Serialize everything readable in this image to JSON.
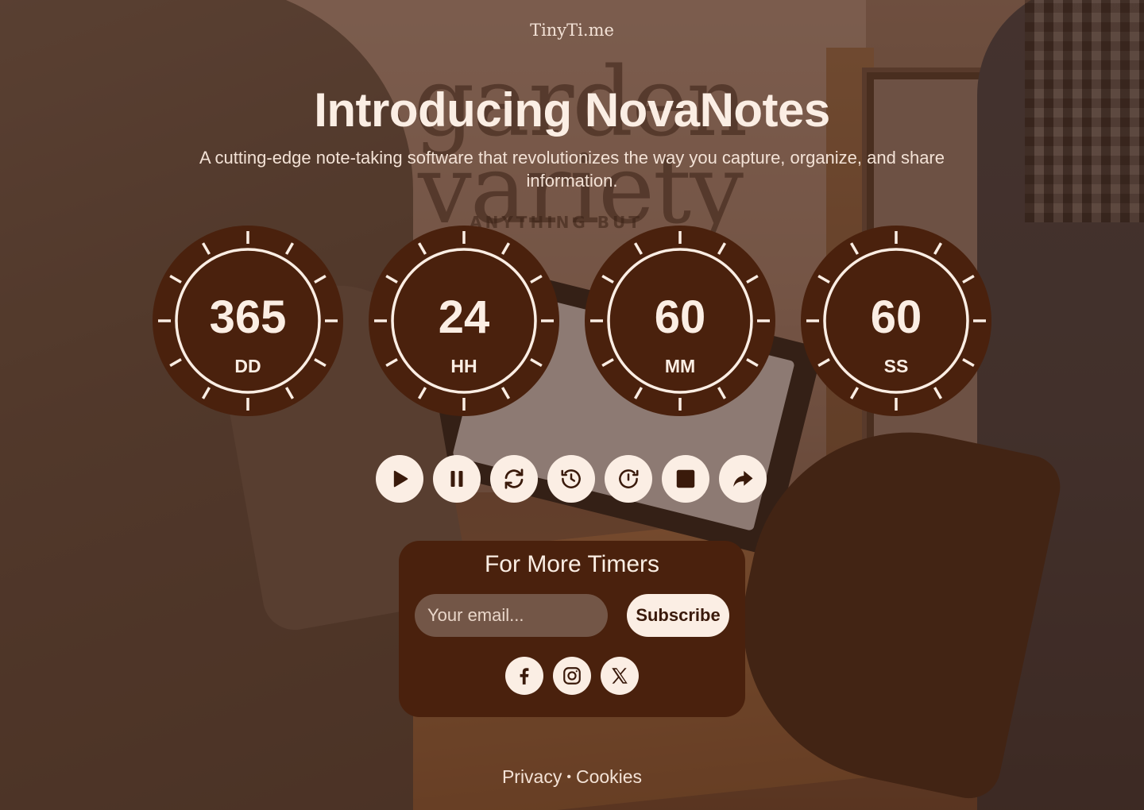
{
  "brand": "TinyTi.me",
  "header": {
    "title": "Introducing NovaNotes",
    "subtitle": "A cutting-edge note-taking software that revolutionizes the way you capture, organize, and share information."
  },
  "countdown": [
    {
      "value": "365",
      "unit": "DD"
    },
    {
      "value": "24",
      "unit": "HH"
    },
    {
      "value": "60",
      "unit": "MM"
    },
    {
      "value": "60",
      "unit": "SS"
    }
  ],
  "controls": [
    "play-icon",
    "pause-icon",
    "refresh-icon",
    "history-icon",
    "timer-reset-icon",
    "stop-icon",
    "share-icon"
  ],
  "subscribe": {
    "title": "For More Timers",
    "email_placeholder": "Your email...",
    "button_label": "Subscribe"
  },
  "social": [
    "facebook-icon",
    "instagram-icon",
    "x-icon"
  ],
  "footer": {
    "privacy": "Privacy",
    "separator": "•",
    "cookies": "Cookies"
  },
  "colors": {
    "dial_fill": "#4a210d",
    "accent_light": "#fbeee4",
    "overlay": "#482412"
  }
}
